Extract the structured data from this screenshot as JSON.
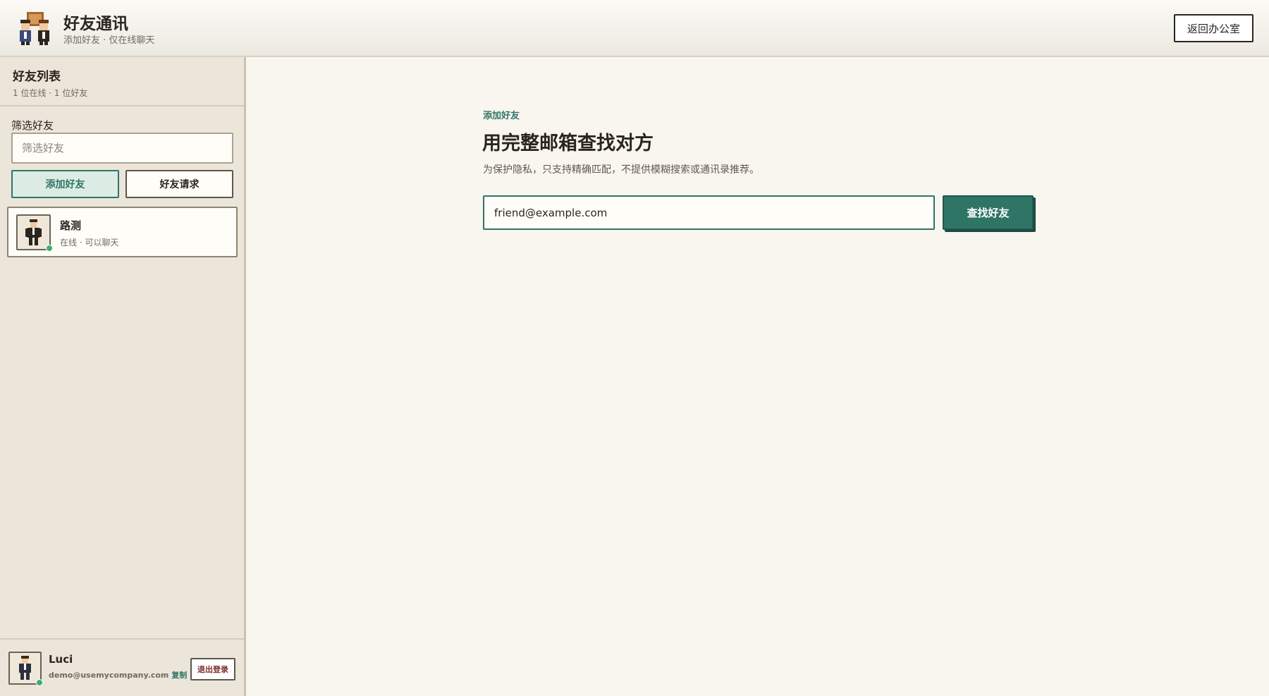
{
  "header": {
    "title": "好友通讯",
    "subtitle": "添加好友 · 仅在线聊天",
    "back_label": "返回办公室"
  },
  "sidebar": {
    "title": "好友列表",
    "meta": "1 位在线 · 1 位好友",
    "filter_label": "筛选好友",
    "filter_placeholder": "筛选好友",
    "tabs": {
      "add": "添加好友",
      "requests": "好友请求"
    },
    "friends": [
      {
        "name": "路测",
        "status": "在线 · 可以聊天",
        "online": true
      }
    ],
    "me": {
      "name": "Luci",
      "email": "demo@usemycompany.com",
      "copy_label": "复制",
      "logout_label": "退出登录"
    }
  },
  "main": {
    "eyebrow": "添加好友",
    "headline": "用完整邮箱查找对方",
    "description": "为保护隐私，只支持精确匹配，不提供模糊搜索或通讯录推荐。",
    "email_value": "friend@example.com",
    "find_label": "查找好友"
  },
  "colors": {
    "accent": "#2f7566",
    "online": "#3fae6f",
    "sidebar_bg": "#ece6da",
    "main_bg": "#f9f6ef"
  }
}
